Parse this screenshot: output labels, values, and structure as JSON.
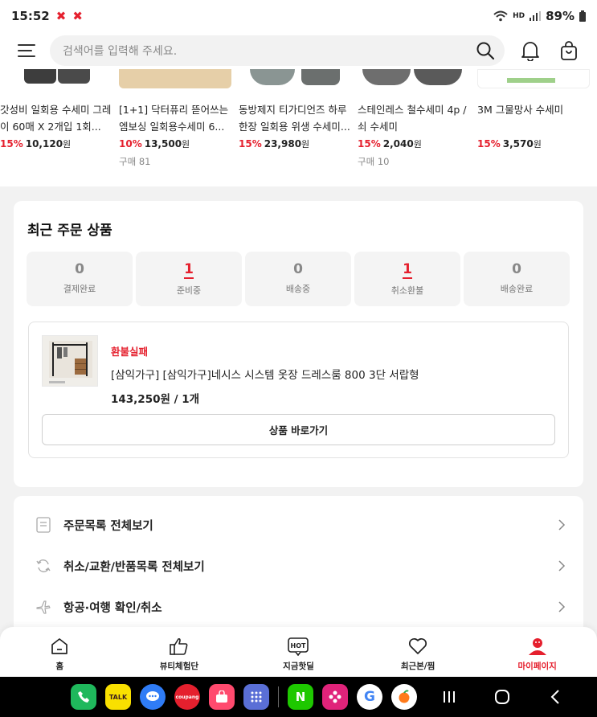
{
  "status_bar": {
    "time": "15:52",
    "alert_marks": [
      "✖",
      "✖"
    ],
    "network": "HD",
    "battery": "89%"
  },
  "header": {
    "search_placeholder": "검색어를 입력해 주세요.",
    "icons": [
      "menu-icon",
      "search-icon",
      "bell-icon",
      "cart-icon"
    ]
  },
  "products": [
    {
      "name": "갓성비 일회용 수세미 그레이 60매 X 2개입 1회...",
      "discount": "15%",
      "price": "10,120",
      "unit": "원",
      "bought": ""
    },
    {
      "name": "[1+1] 닥터퓨리 뜯어쓰는 엠보싱 일회용수세미 6...",
      "discount": "10%",
      "price": "13,500",
      "unit": "원",
      "bought": "구매 81"
    },
    {
      "name": "동방제지 티가디언즈 하루 한장 일회용 위생 수세미...",
      "discount": "15%",
      "price": "23,980",
      "unit": "원",
      "bought": ""
    },
    {
      "name": "스테인레스 철수세미 4p / 쇠 수세미",
      "discount": "15%",
      "price": "2,040",
      "unit": "원",
      "bought": "구매 10"
    },
    {
      "name": "3M 그물망사 수세미",
      "discount": "15%",
      "price": "3,570",
      "unit": "원",
      "bought": ""
    }
  ],
  "recent_orders": {
    "title": "최근 주문 상품",
    "steps": [
      {
        "count": "0",
        "label": "결제완료",
        "highlight": false
      },
      {
        "count": "1",
        "label": "준비중",
        "highlight": true
      },
      {
        "count": "0",
        "label": "배송중",
        "highlight": false
      },
      {
        "count": "1",
        "label": "취소환불",
        "highlight": true
      },
      {
        "count": "0",
        "label": "배송완료",
        "highlight": false
      }
    ],
    "order": {
      "status": "환불실패",
      "name": "[삼익가구] [삼익가구]네시스 시스템 옷장 드레스룸 800 3단 서랍형",
      "price_qty": "143,250원 / 1개",
      "button": "상품 바로가기"
    }
  },
  "links": [
    {
      "label": "주문목록 전체보기",
      "icon": "list-icon"
    },
    {
      "label": "취소/교환/반품목록 전체보기",
      "icon": "refresh-icon"
    },
    {
      "label": "항공·여행 확인/취소",
      "icon": "airplane-icon"
    }
  ],
  "bottom_nav": [
    {
      "label": "홈",
      "icon": "home-icon",
      "active": false
    },
    {
      "label": "뷰티체험단",
      "icon": "thumbs-up-icon",
      "active": false
    },
    {
      "label": "지금핫딜",
      "icon": "hot-icon",
      "active": false,
      "badge": "HOT"
    },
    {
      "label": "최근본/찜",
      "icon": "heart-icon",
      "active": false
    },
    {
      "label": "마이페이지",
      "icon": "user-icon",
      "active": true
    }
  ],
  "system_apps": [
    {
      "name": "phone-app",
      "label": "",
      "color": "#1fb85c"
    },
    {
      "name": "kakaotalk-app",
      "label": "TALK",
      "color": "#f9e000"
    },
    {
      "name": "messages-app",
      "label": "",
      "color": "#2f7cf6"
    },
    {
      "name": "coupang-app",
      "label": "coupang",
      "color": "#e5202e"
    },
    {
      "name": "shopping-app",
      "label": "",
      "color": "#ff4a6e"
    },
    {
      "name": "apps-grid",
      "label": "",
      "color": "#5a6fd6"
    },
    {
      "name": "naver-app",
      "label": "N",
      "color": "#1ec800"
    },
    {
      "name": "flower-app",
      "label": "",
      "color": "#e0237a"
    },
    {
      "name": "google-app",
      "label": "G",
      "color": "#ffffff"
    },
    {
      "name": "fruit-app",
      "label": "",
      "color": "#ffffff"
    }
  ],
  "colors": {
    "accent": "#e5202e",
    "background": "#f2f2f2"
  }
}
